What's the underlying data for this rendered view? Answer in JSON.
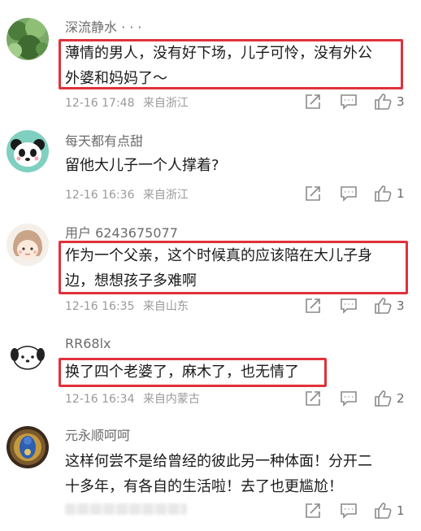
{
  "comments": [
    {
      "username": "深流静水 · · ·",
      "text_lines": [
        "薄情的男人，没有好下场，儿子可怜，没有外公",
        "外婆和妈妈了～"
      ],
      "date": "12-16 17:48",
      "location": "来自浙江",
      "likes": "3",
      "highlighted": true,
      "avatar_icon": "leaves-avatar-icon"
    },
    {
      "username": "每天都有点甜",
      "text_lines": [
        "留他大儿子一个人撑着?"
      ],
      "date": "12-16 16:36",
      "location": "来自浙江",
      "likes": "1",
      "highlighted": false,
      "avatar_icon": "panda-avatar-icon"
    },
    {
      "username": "用户 6243675077",
      "text_lines": [
        "作为一个父亲，这个时候真的应该陪在大儿子身",
        "边，想想孩子多难啊"
      ],
      "date": "12-16 16:35",
      "location": "来自山东",
      "likes": "3",
      "highlighted": true,
      "avatar_icon": "cartoon-girl-avatar-icon"
    },
    {
      "username": "RR68lx",
      "text_lines": [
        "换了四个老婆了，麻木了，也无情了"
      ],
      "date": "12-16 16:34",
      "location": "来自内蒙古",
      "likes": "2",
      "highlighted": true,
      "avatar_icon": "dog-avatar-icon"
    },
    {
      "username": "元永顺呵呵",
      "text_lines": [
        "这样何尝不是给曾经的彼此另一种体面！分开二",
        "十多年，有各自的生活啦！去了也更尴尬！"
      ],
      "date": "",
      "location": "",
      "likes": "1",
      "highlighted": false,
      "avatar_icon": "blue-buddha-avatar-icon"
    }
  ],
  "colors": {
    "highlight_border": "#e0313b",
    "username": "#6b6b6b",
    "meta": "#9a9a9a",
    "text": "#1a1a1a"
  }
}
